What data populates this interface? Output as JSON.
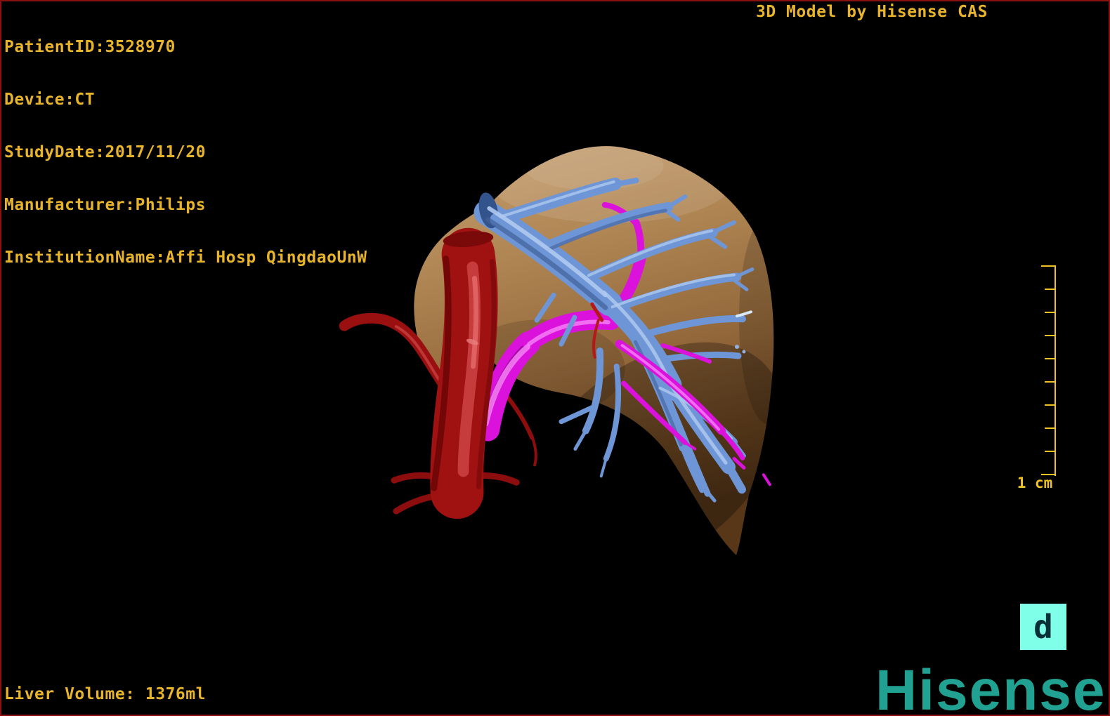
{
  "colors": {
    "background": "#000000",
    "border": "#8B1111",
    "text_yellow": "#E8B42C",
    "scale_yellow": "#F0C224",
    "hisense_teal": "#21A191",
    "icon_cyan": "#80FFE8",
    "icon_glyph": "#083038",
    "liver_tan": "#AD8452",
    "vein_blue": "#6E96D6",
    "portal_magenta": "#DB12DB",
    "artery_red": "#A01111"
  },
  "header": {
    "patient_info_lines": [
      "PatientID:3528970",
      "Device:CT",
      "StudyDate:2017/11/20",
      "Manufacturer:Philips",
      "InstitutionName:Affi Hosp QingdaoUnW"
    ],
    "title": "3D Model by Hisense CAS"
  },
  "footer": {
    "liver_volume": "Liver Volume: 1376ml",
    "brand": "Hisense"
  },
  "scale_bar": {
    "label": "1 cm",
    "tick_count": 10
  },
  "viewer_icon": {
    "glyph": "d"
  }
}
